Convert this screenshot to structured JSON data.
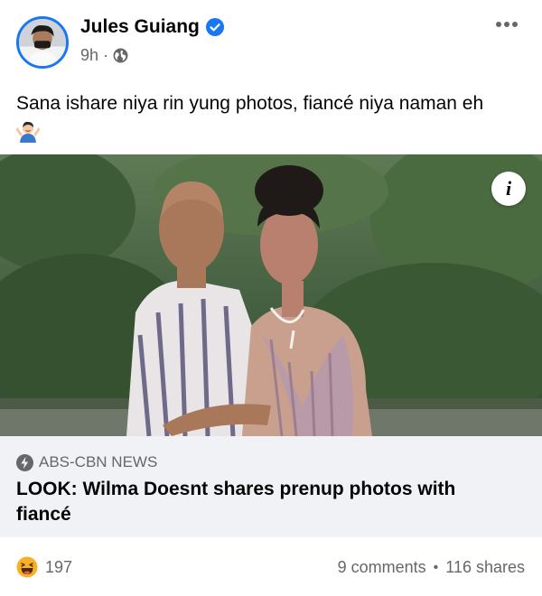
{
  "post": {
    "author": "Jules Guiang",
    "time": "9h",
    "separator": "·",
    "text": "Sana ishare niya rin yung photos, fiancé niya naman eh",
    "icons": [
      "verified-badge-icon",
      "globe-icon",
      "more-options-icon",
      "shrug-emoji-icon"
    ]
  },
  "link": {
    "source": "ABS-CBN NEWS",
    "title": "LOOK: Wilma Doesnt shares prenup photos with fiancé",
    "info_label": "i"
  },
  "footer": {
    "reaction_count": "197",
    "comments": "9 comments",
    "separator": "•",
    "shares": "116 shares"
  },
  "colors": {
    "accent": "#1877f2",
    "secondary_text": "#65676b",
    "caption_bg": "#f0f2f5"
  }
}
